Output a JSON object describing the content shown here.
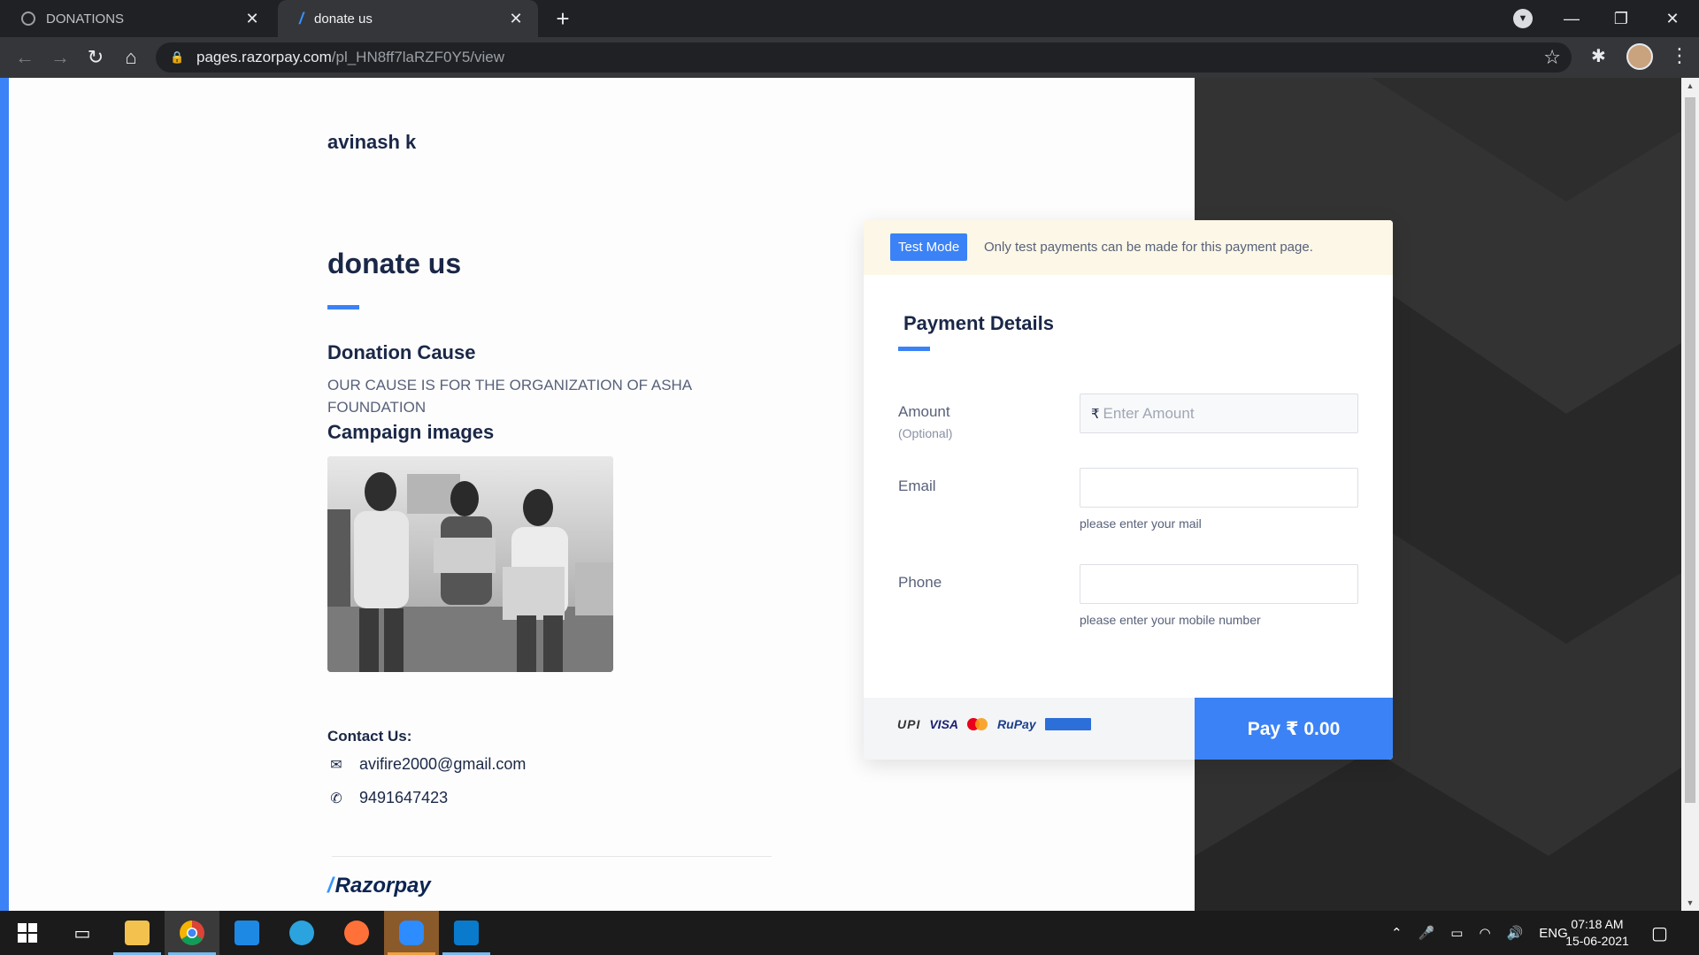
{
  "browser": {
    "tabs": [
      {
        "title": "DONATIONS",
        "active": false
      },
      {
        "title": "donate us",
        "active": true
      }
    ],
    "url_host": "pages.razorpay.com",
    "url_path": "/pl_HN8ff7laRZF0Y5/view"
  },
  "page": {
    "merchant_name": "avinash k",
    "title": "donate us",
    "cause_heading": "Donation Cause",
    "cause_text": "OUR CAUSE IS FOR THE ORGANIZATION OF ASHA FOUNDATION",
    "images_heading": "Campaign images",
    "contact_heading": "Contact Us:",
    "contact_email": "avifire2000@gmail.com",
    "contact_phone": "9491647423",
    "brand": "Razorpay"
  },
  "payment": {
    "test_badge": "Test Mode",
    "test_message": "Only test payments can be made for this payment page.",
    "heading": "Payment Details",
    "amount_label": "Amount",
    "amount_optional": "(Optional)",
    "currency_symbol": "₹",
    "amount_placeholder": "Enter Amount",
    "email_label": "Email",
    "email_help": "please enter your mail",
    "phone_label": "Phone",
    "phone_help": "please enter your mobile number",
    "pay_button": "Pay  ₹ 0.00",
    "methods": [
      "UPI",
      "VISA",
      "RuPay"
    ]
  },
  "taskbar": {
    "language": "ENG",
    "time": "07:18 AM",
    "date": "15-06-2021"
  },
  "colors": {
    "accent": "#3b82f6",
    "heading": "#1a2747",
    "test_banner": "#fcf7e6"
  }
}
